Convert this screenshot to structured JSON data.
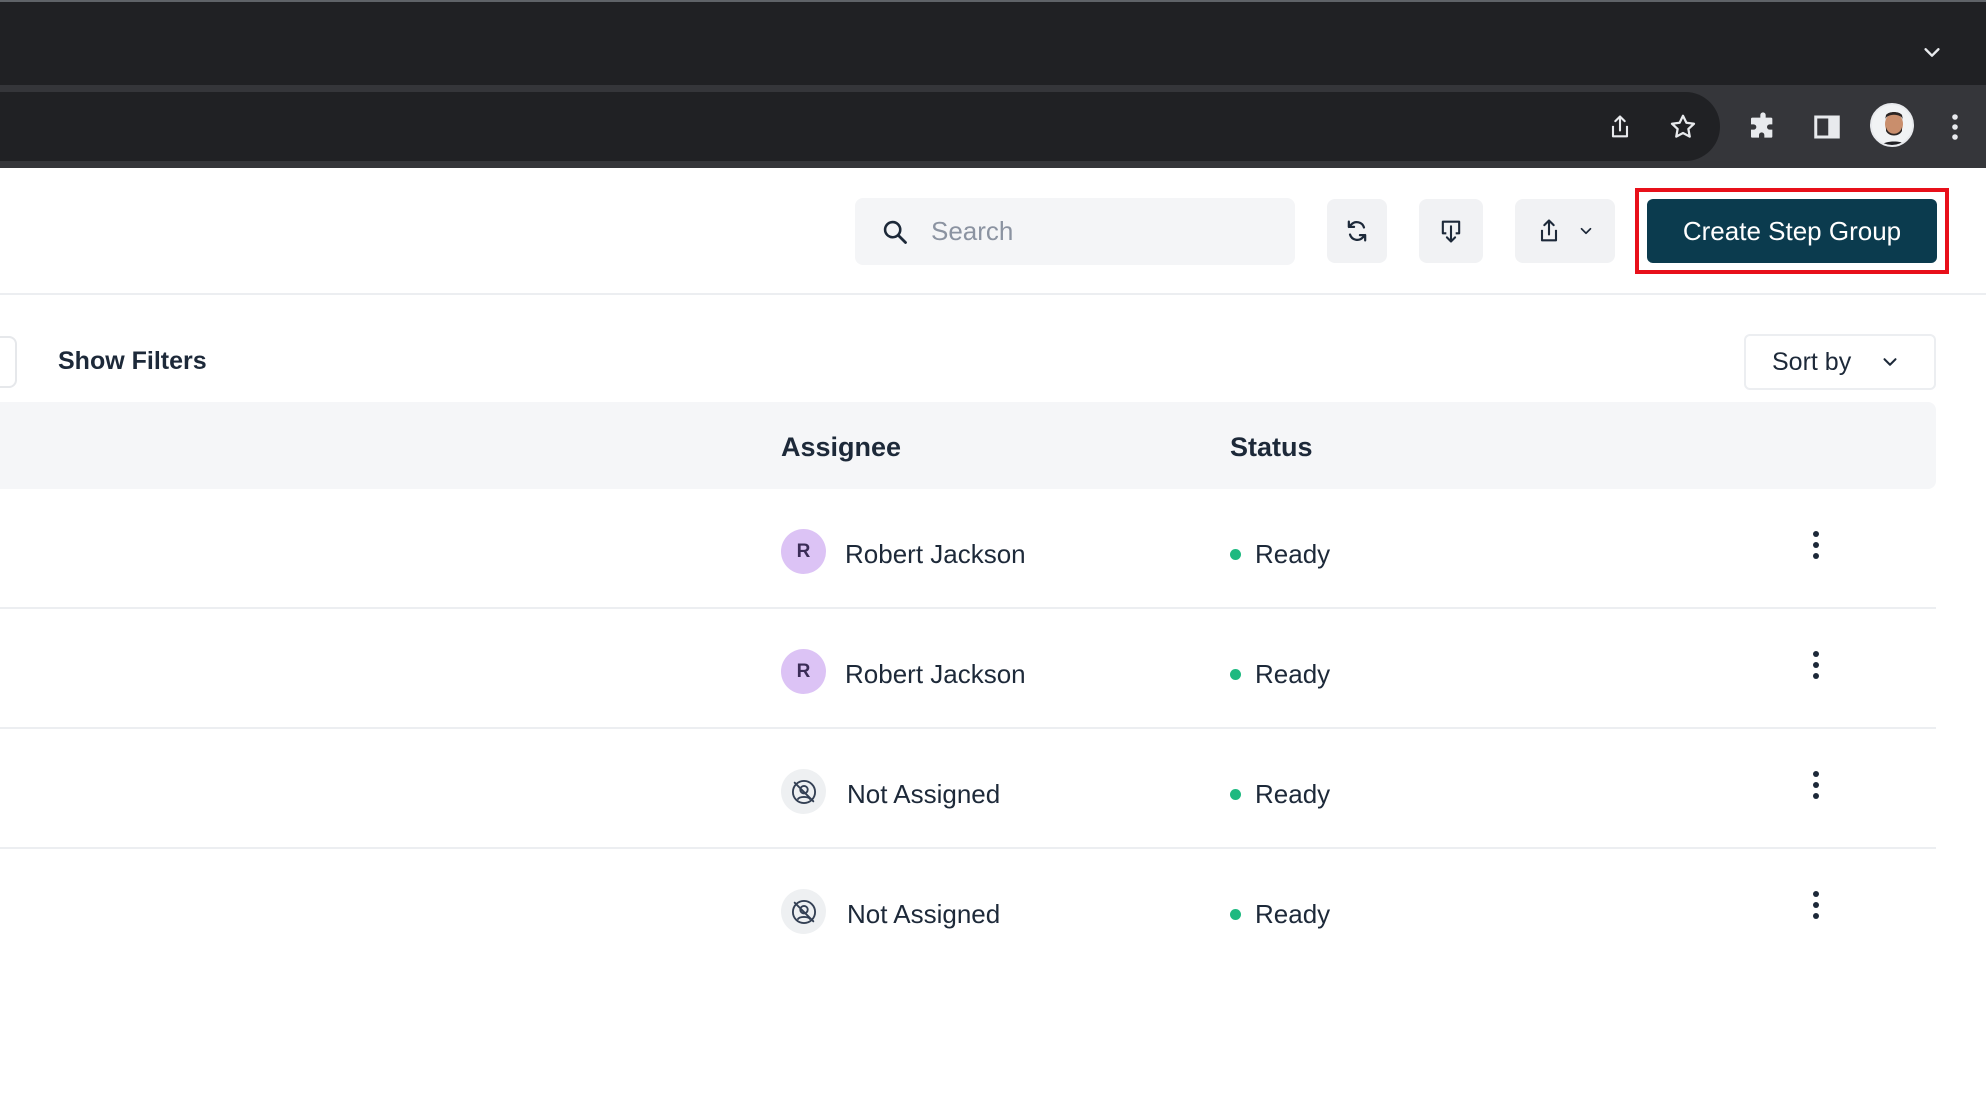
{
  "browser": {
    "icons": {
      "tab_search": "chevron-down-icon",
      "share": "share-icon",
      "bookmark": "star-icon",
      "extensions": "puzzle-icon",
      "side_panel": "side-panel-icon",
      "profile": "profile-avatar",
      "menu": "kebab-menu-icon"
    }
  },
  "header": {
    "search": {
      "placeholder": "Search",
      "value": ""
    },
    "refresh_icon": "refresh-icon",
    "download_icon": "download-icon",
    "export_icon": "export-icon",
    "create_button": "Create Step Group",
    "accent_color": "#0b3b4e",
    "highlight_color": "#e8101a"
  },
  "filters": {
    "show_filters": "Show Filters",
    "sort_by": "Sort by"
  },
  "table": {
    "columns": {
      "assignee": "Assignee",
      "status": "Status"
    },
    "rows": [
      {
        "avatar_initial": "R",
        "assignee": "Robert Jackson",
        "status": "Ready",
        "status_color": "#1eb980"
      },
      {
        "avatar_initial": "R",
        "assignee": "Robert Jackson",
        "status": "Ready",
        "status_color": "#1eb980"
      },
      {
        "avatar_initial": "",
        "assignee": "Not Assigned",
        "status": "Ready",
        "status_color": "#1eb980"
      },
      {
        "avatar_initial": "",
        "assignee": "Not Assigned",
        "status": "Ready",
        "status_color": "#1eb980"
      }
    ]
  }
}
